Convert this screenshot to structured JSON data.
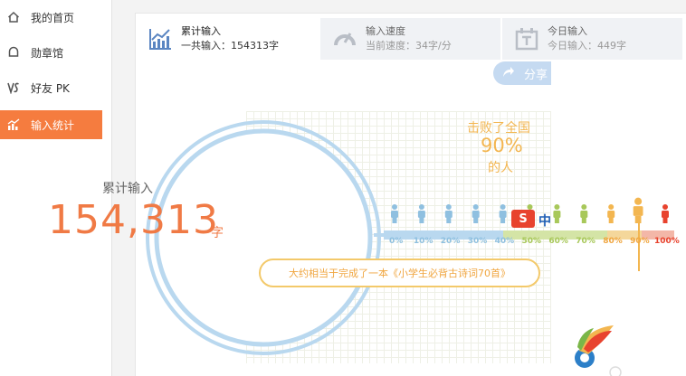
{
  "sidebar": {
    "items": [
      {
        "label": "我的首页",
        "icon": "home-icon"
      },
      {
        "label": "勋章馆",
        "icon": "medal-icon"
      },
      {
        "label": "好友 PK",
        "icon": "vs-icon"
      },
      {
        "label": "输入统计",
        "icon": "stats-icon",
        "active": true
      }
    ]
  },
  "tabs": [
    {
      "title": "累计输入",
      "sub": "一共输入：154313字",
      "icon": "trend-chart-icon",
      "active": true
    },
    {
      "title": "输入速度",
      "sub": "当前速度：34字/分",
      "icon": "speedometer-icon"
    },
    {
      "title": "今日输入",
      "sub": "今日输入：449字",
      "icon": "calendar-icon"
    }
  ],
  "share_label": "分享",
  "circle": {
    "label": "累计输入",
    "value": "154,313",
    "unit": "字"
  },
  "beat": {
    "line1": "击败了全国",
    "percent": "90%",
    "line2": "的人"
  },
  "scale": {
    "labels": [
      "0%",
      "10%",
      "20%",
      "30%",
      "40%",
      "50%",
      "60%",
      "70%",
      "80%",
      "90%",
      "100%"
    ],
    "position": 0.9
  },
  "banner_text": "大约相当于完成了一本《小学生必背古诗词70首》",
  "badge": {
    "letter": "S",
    "zh": "中"
  },
  "colors": {
    "accent": "#f57c3f",
    "circle": "#b9d8ef",
    "number": "#f07a45",
    "yellow": "#f3b650",
    "blue_person": "#8fc0e0",
    "green_person": "#a8c85a",
    "orange_person": "#f3b650"
  }
}
